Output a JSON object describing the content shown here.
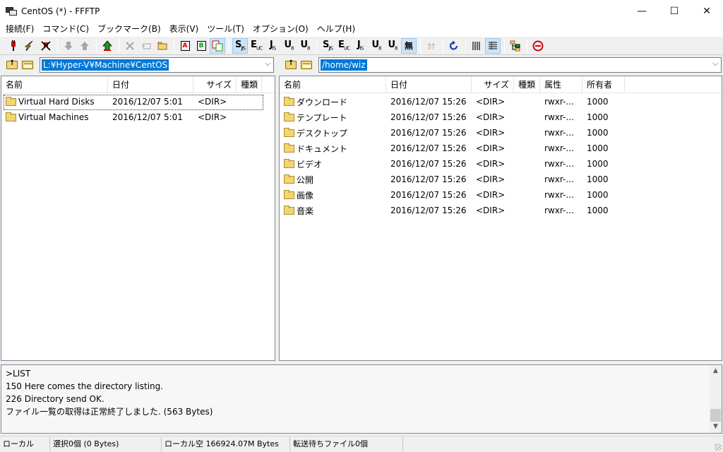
{
  "window": {
    "title": "CentOS (*) - FFFTP",
    "minimize": "—",
    "maximize": "☐",
    "close": "✕"
  },
  "menu": [
    "接続(F)",
    "コマンド(C)",
    "ブックマーク(B)",
    "表示(V)",
    "ツール(T)",
    "オプション(O)",
    "ヘルプ(H)"
  ],
  "toolbar": {
    "codes_right": [
      {
        "main": "S",
        "sub": "JIS"
      },
      {
        "main": "E",
        "sub": "UC"
      },
      {
        "main": "J",
        "sub": "IS"
      },
      {
        "main": "U",
        "sub": "8"
      },
      {
        "main": "U",
        "sub": "8"
      }
    ],
    "codes_left_local": [
      {
        "main": "S",
        "sub": "JIS"
      },
      {
        "main": "E",
        "sub": "UC"
      },
      {
        "main": "J",
        "sub": "IS"
      },
      {
        "main": "U",
        "sub": "8"
      },
      {
        "main": "U",
        "sub": "8"
      }
    ],
    "no_conversion_label": "無",
    "kana_label": "ｶﾅ",
    "ascii_label": "A",
    "binary_label": "B"
  },
  "local": {
    "path": "L:¥Hyper-V¥Machine¥CentOS",
    "columns": [
      "名前",
      "日付",
      "サイズ",
      "種類"
    ],
    "rows": [
      {
        "name": "Virtual Hard Disks",
        "date": "2016/12/07   5:01",
        "size": "<DIR>",
        "type": ""
      },
      {
        "name": "Virtual Machines",
        "date": "2016/12/07   5:01",
        "size": "<DIR>",
        "type": ""
      }
    ]
  },
  "remote": {
    "path": "/home/wiz",
    "columns": [
      "名前",
      "日付",
      "サイズ",
      "種類",
      "属性",
      "所有者"
    ],
    "rows": [
      {
        "name": "ダウンロード",
        "date": "2016/12/07 15:26",
        "size": "<DIR>",
        "type": "",
        "attr": "rwxr-...",
        "owner": "1000"
      },
      {
        "name": "テンプレート",
        "date": "2016/12/07 15:26",
        "size": "<DIR>",
        "type": "",
        "attr": "rwxr-...",
        "owner": "1000"
      },
      {
        "name": "デスクトップ",
        "date": "2016/12/07 15:26",
        "size": "<DIR>",
        "type": "",
        "attr": "rwxr-...",
        "owner": "1000"
      },
      {
        "name": "ドキュメント",
        "date": "2016/12/07 15:26",
        "size": "<DIR>",
        "type": "",
        "attr": "rwxr-...",
        "owner": "1000"
      },
      {
        "name": "ビデオ",
        "date": "2016/12/07 15:26",
        "size": "<DIR>",
        "type": "",
        "attr": "rwxr-...",
        "owner": "1000"
      },
      {
        "name": "公開",
        "date": "2016/12/07 15:26",
        "size": "<DIR>",
        "type": "",
        "attr": "rwxr-...",
        "owner": "1000"
      },
      {
        "name": "画像",
        "date": "2016/12/07 15:26",
        "size": "<DIR>",
        "type": "",
        "attr": "rwxr-...",
        "owner": "1000"
      },
      {
        "name": "音楽",
        "date": "2016/12/07 15:26",
        "size": "<DIR>",
        "type": "",
        "attr": "rwxr-...",
        "owner": "1000"
      }
    ]
  },
  "log": [
    ">LIST",
    "150 Here comes the directory listing.",
    "226 Directory send OK.",
    "ファイル一覧の取得は正常終了しました. (563 Bytes)"
  ],
  "status": {
    "mode": "ローカル",
    "selection": "選択0個  (0 Bytes)",
    "free": "ローカル空 166924.07M Bytes",
    "queue": "転送待ちファイル0個"
  },
  "colors": {
    "selection": "#0078d7",
    "folder": "#f2d574",
    "accent_red": "#d40000",
    "accent_green": "#1a9a1a"
  }
}
